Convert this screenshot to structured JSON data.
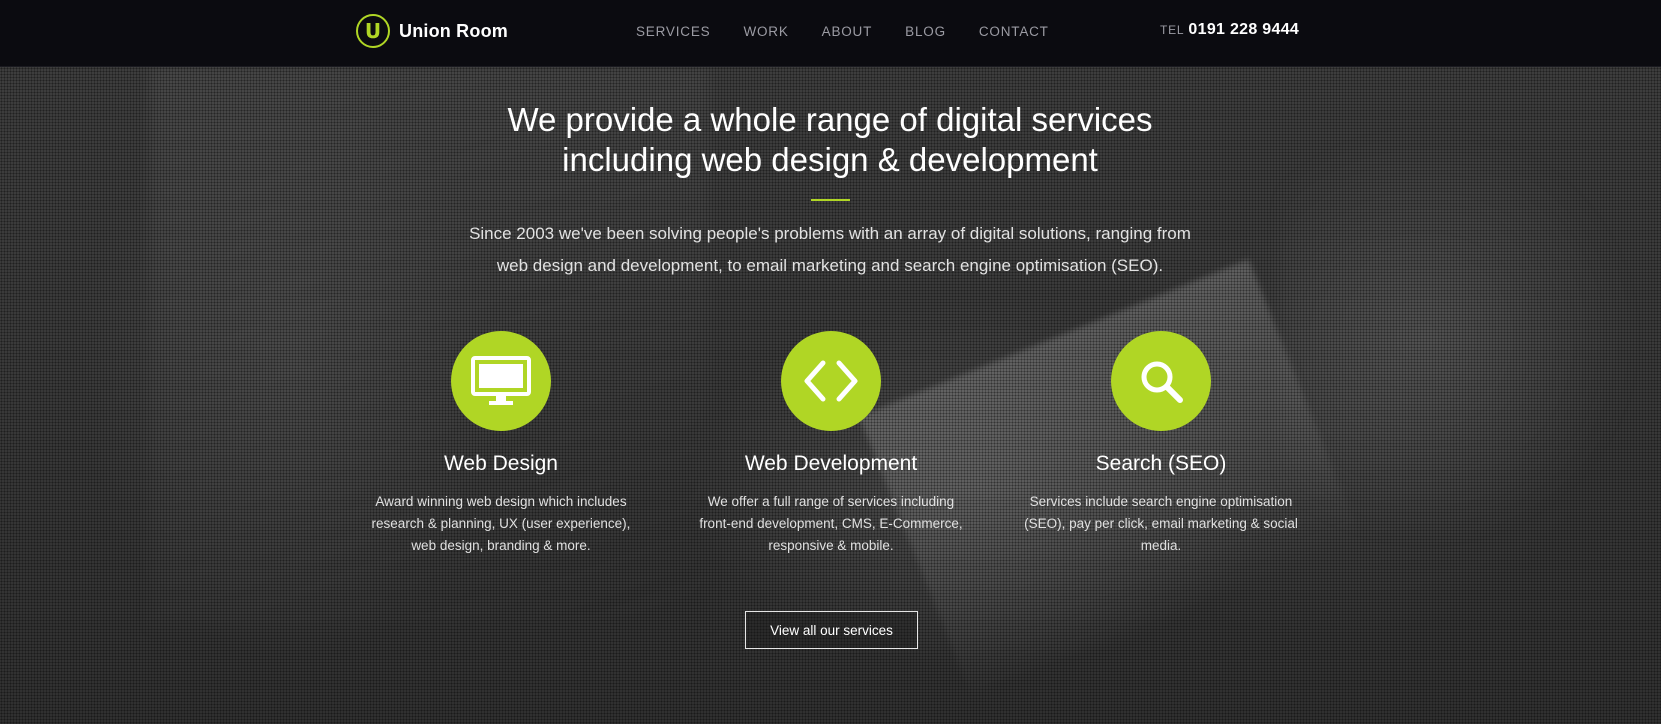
{
  "header": {
    "logo_letter": "U",
    "brand": "Union Room",
    "nav": [
      "SERVICES",
      "WORK",
      "ABOUT",
      "BLOG",
      "CONTACT"
    ],
    "tel_label": "TEL",
    "tel_number": "0191 228 9444"
  },
  "hero": {
    "headline_line1": "We provide a whole range of digital services",
    "headline_line2": "including web design & development",
    "intro_line1": "Since 2003 we've been solving people's problems with an array of digital solutions, ranging from",
    "intro_line2": "web design and development, to email marketing and search engine optimisation (SEO).",
    "services": [
      {
        "icon": "monitor-icon",
        "title": "Web Design",
        "desc_lines": [
          "Award winning web design which includes",
          "research & planning, UX (user experience),",
          "web design, branding & more."
        ]
      },
      {
        "icon": "code-brackets-icon",
        "title": "Web Development",
        "desc_lines": [
          "We offer a full range of services including",
          "front-end development, CMS, E-Commerce,",
          "responsive & mobile."
        ]
      },
      {
        "icon": "search-icon",
        "title": "Search (SEO)",
        "desc_lines": [
          "Services include search engine optimisation",
          "(SEO), pay per click, email marketing & social",
          "media."
        ]
      }
    ],
    "cta_label": "View all our services"
  },
  "colors": {
    "accent": "#b0d625",
    "header_bg": "#0b0b10",
    "text": "#ffffff",
    "nav_text": "#9b9ba3"
  }
}
